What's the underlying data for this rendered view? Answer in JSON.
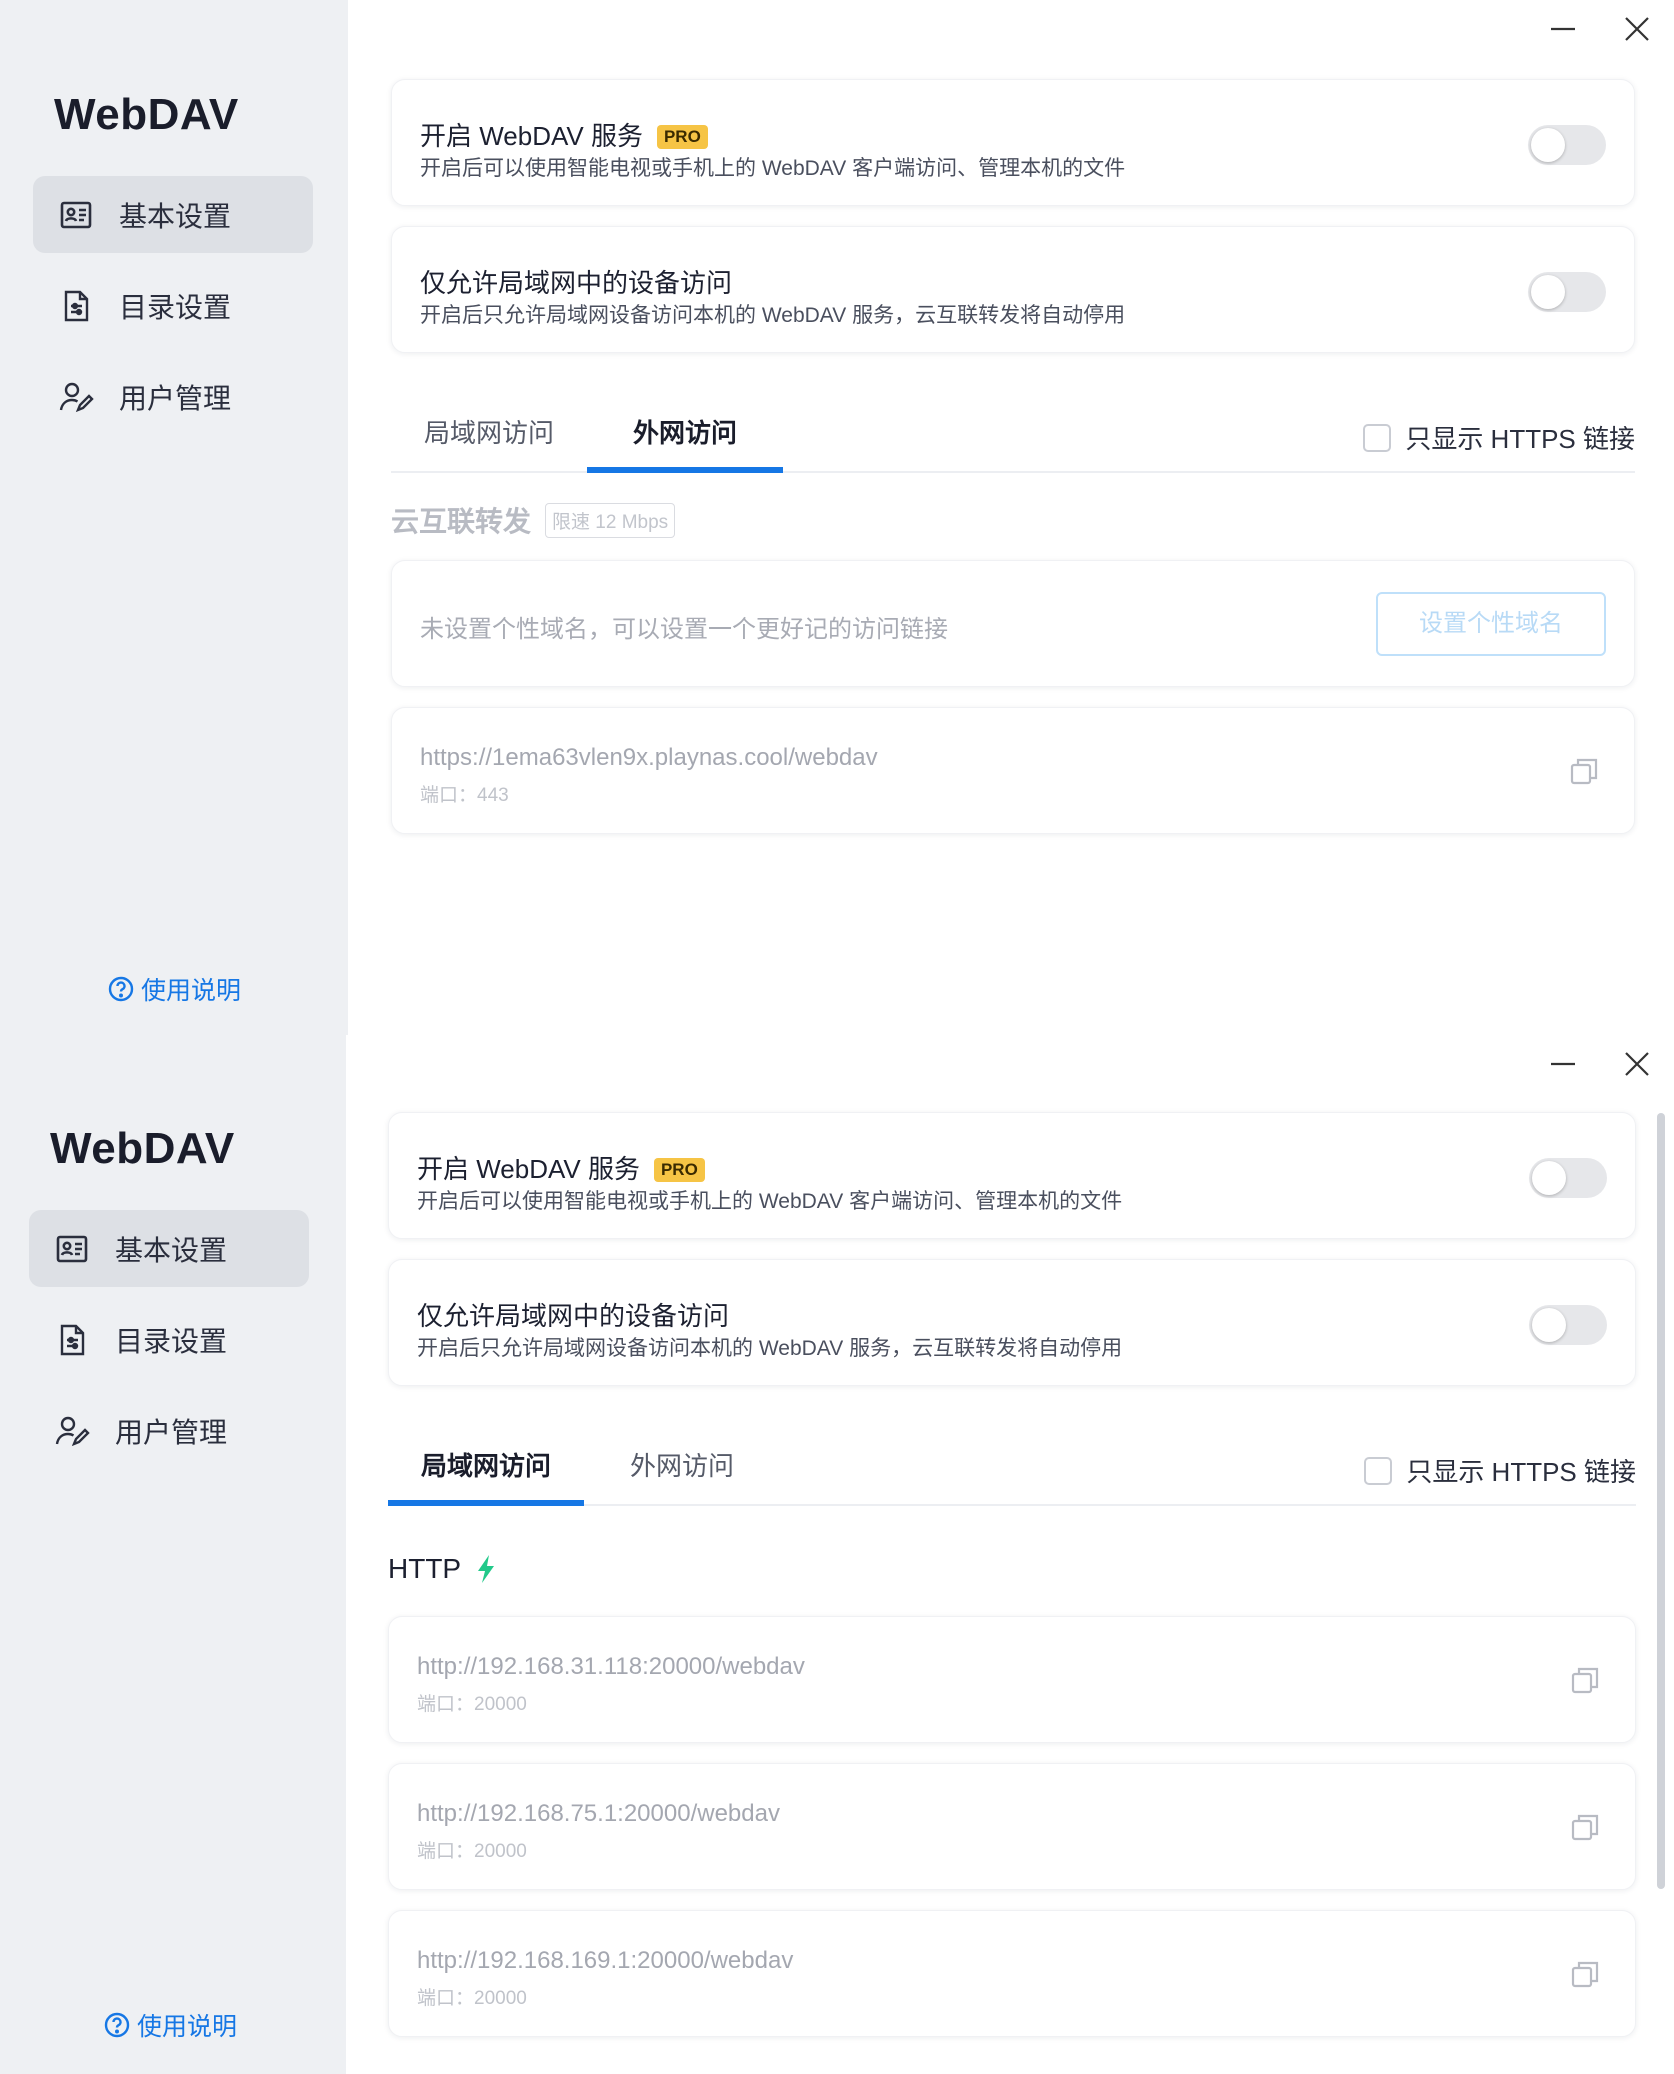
{
  "app": {
    "title": "WebDAV",
    "nav": [
      "基本设置",
      "目录设置",
      "用户管理"
    ],
    "help": "使用说明"
  },
  "settings": {
    "webdav_title": "开启 WebDAV 服务",
    "pro_badge": "PRO",
    "webdav_desc": "开启后可以使用智能电视或手机上的 WebDAV 客户端访问、管理本机的文件",
    "lan_only_title": "仅允许局域网中的设备访问",
    "lan_only_desc": "开启后只允许局域网设备访问本机的 WebDAV 服务，云互联转发将自动停用"
  },
  "tabs": {
    "lan": "局域网访问",
    "wan": "外网访问",
    "https_only": "只显示 HTTPS 链接"
  },
  "wan": {
    "section": "云互联转发",
    "limit": "限速 12 Mbps",
    "domain_hint": "未设置个性域名，可以设置一个更好记的访问链接",
    "domain_button": "设置个性域名",
    "url": "https://1ema63vlen9x.playnas.cool/webdav",
    "port": "端口：443"
  },
  "lan": {
    "section": "HTTP",
    "links": [
      {
        "url": "http://192.168.31.118:20000/webdav",
        "port": "端口：20000"
      },
      {
        "url": "http://192.168.75.1:20000/webdav",
        "port": "端口：20000"
      },
      {
        "url": "http://192.168.169.1:20000/webdav",
        "port": "端口：20000"
      }
    ]
  },
  "colors": {
    "accent": "#1677e5",
    "pro": "#f6c445",
    "bolt": "#22c98a",
    "sidebar": "#eef0f3"
  }
}
